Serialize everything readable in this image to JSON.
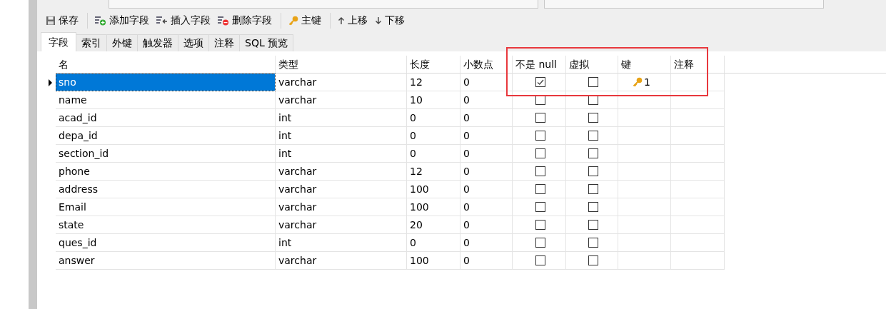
{
  "toolbar": [
    {
      "label": "保存"
    },
    {
      "label": "添加字段"
    },
    {
      "label": "插入字段"
    },
    {
      "label": "删除字段"
    },
    {
      "label": "主键"
    },
    {
      "label": "上移"
    },
    {
      "label": "下移"
    }
  ],
  "tabs": [
    {
      "label": "字段",
      "selected": true
    },
    {
      "label": "索引",
      "selected": false
    },
    {
      "label": "外键",
      "selected": false
    },
    {
      "label": "触发器",
      "selected": false
    },
    {
      "label": "选项",
      "selected": false
    },
    {
      "label": "注释",
      "selected": false
    },
    {
      "label": "SQL 预览",
      "selected": false
    }
  ],
  "table": {
    "columns": [
      "名",
      "类型",
      "长度",
      "小数点",
      "不是 null",
      "虚拟",
      "键",
      "注释"
    ],
    "rows": [
      {
        "name": "sno",
        "type": "varchar",
        "length": "12",
        "decimals": "0",
        "not_null": true,
        "virtual": false,
        "key": "1",
        "selected": true
      },
      {
        "name": "name",
        "type": "varchar",
        "length": "10",
        "decimals": "0",
        "not_null": false,
        "virtual": false,
        "selected": false
      },
      {
        "name": "acad_id",
        "type": "int",
        "length": "0",
        "decimals": "0",
        "not_null": false,
        "virtual": false,
        "selected": false
      },
      {
        "name": "depa_id",
        "type": "int",
        "length": "0",
        "decimals": "0",
        "not_null": false,
        "virtual": false,
        "selected": false
      },
      {
        "name": "section_id",
        "type": "int",
        "length": "0",
        "decimals": "0",
        "not_null": false,
        "virtual": false,
        "selected": false
      },
      {
        "name": "phone",
        "type": "varchar",
        "length": "12",
        "decimals": "0",
        "not_null": false,
        "virtual": false,
        "selected": false
      },
      {
        "name": "address",
        "type": "varchar",
        "length": "100",
        "decimals": "0",
        "not_null": false,
        "virtual": false,
        "selected": false
      },
      {
        "name": "Email",
        "type": "varchar",
        "length": "100",
        "decimals": "0",
        "not_null": false,
        "virtual": false,
        "selected": false
      },
      {
        "name": "state",
        "type": "varchar",
        "length": "20",
        "decimals": "0",
        "not_null": false,
        "virtual": false,
        "selected": false
      },
      {
        "name": "ques_id",
        "type": "int",
        "length": "0",
        "decimals": "0",
        "not_null": false,
        "virtual": false,
        "selected": false
      },
      {
        "name": "answer",
        "type": "varchar",
        "length": "100",
        "decimals": "0",
        "not_null": false,
        "virtual": false,
        "selected": false
      }
    ]
  },
  "highlight": {
    "kind": "red-box"
  }
}
